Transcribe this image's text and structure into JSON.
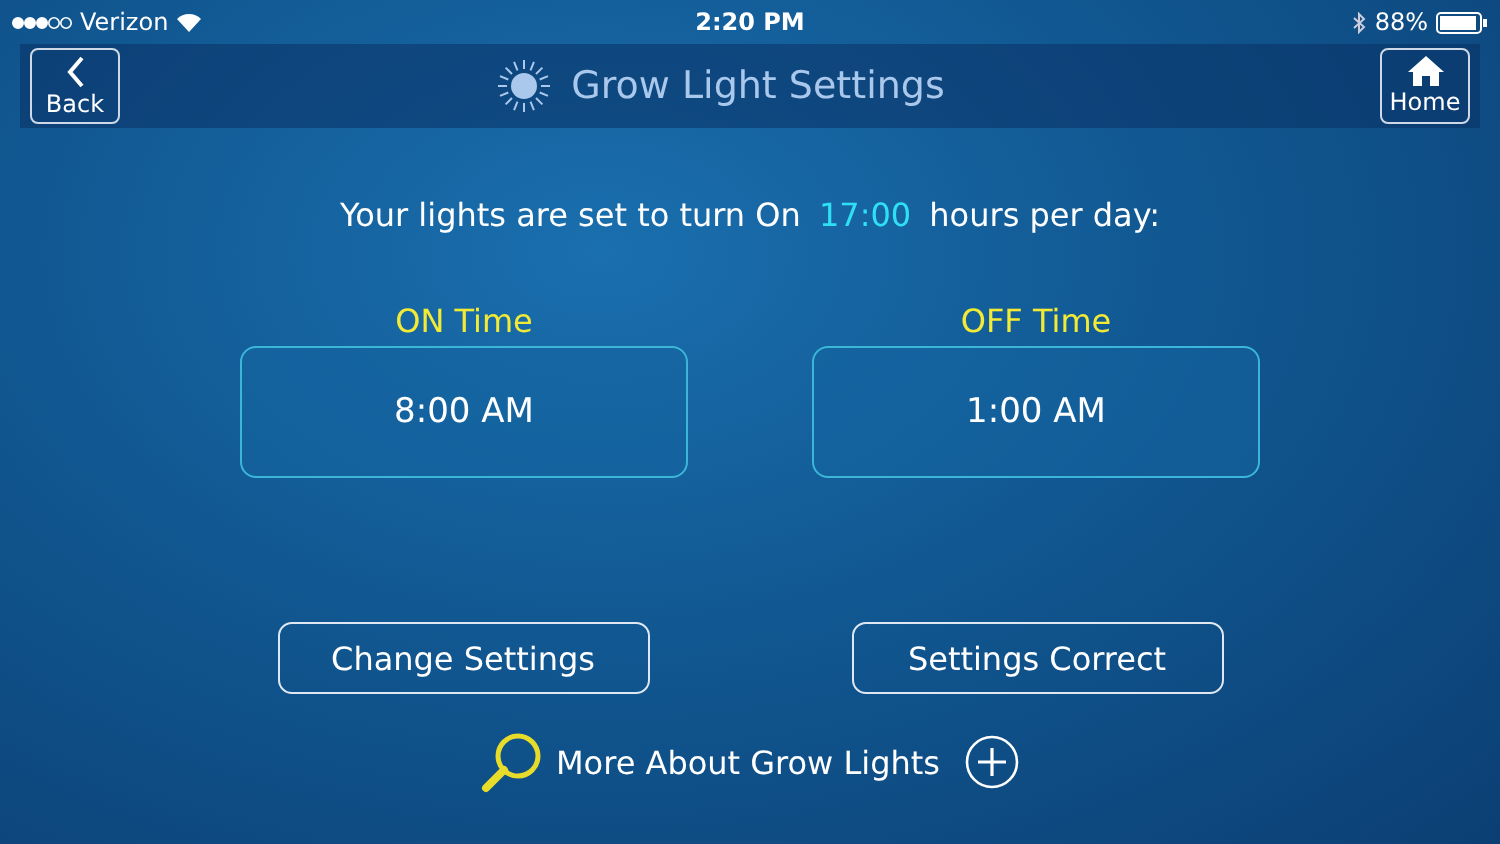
{
  "status_bar": {
    "carrier": "Verizon",
    "time": "2:20 PM",
    "battery": "88%"
  },
  "nav": {
    "back": "Back",
    "title": "Grow Light Settings",
    "home": "Home"
  },
  "summary": {
    "before": "Your lights are set to turn On",
    "hours": "17:00",
    "after": "hours per day:"
  },
  "times": [
    {
      "label": "ON Time",
      "value": "8:00 AM"
    },
    {
      "label": "OFF Time",
      "value": "1:00 AM"
    }
  ],
  "buttons": [
    "Change Settings",
    "Settings Correct"
  ],
  "more_link": "More About Grow Lights"
}
